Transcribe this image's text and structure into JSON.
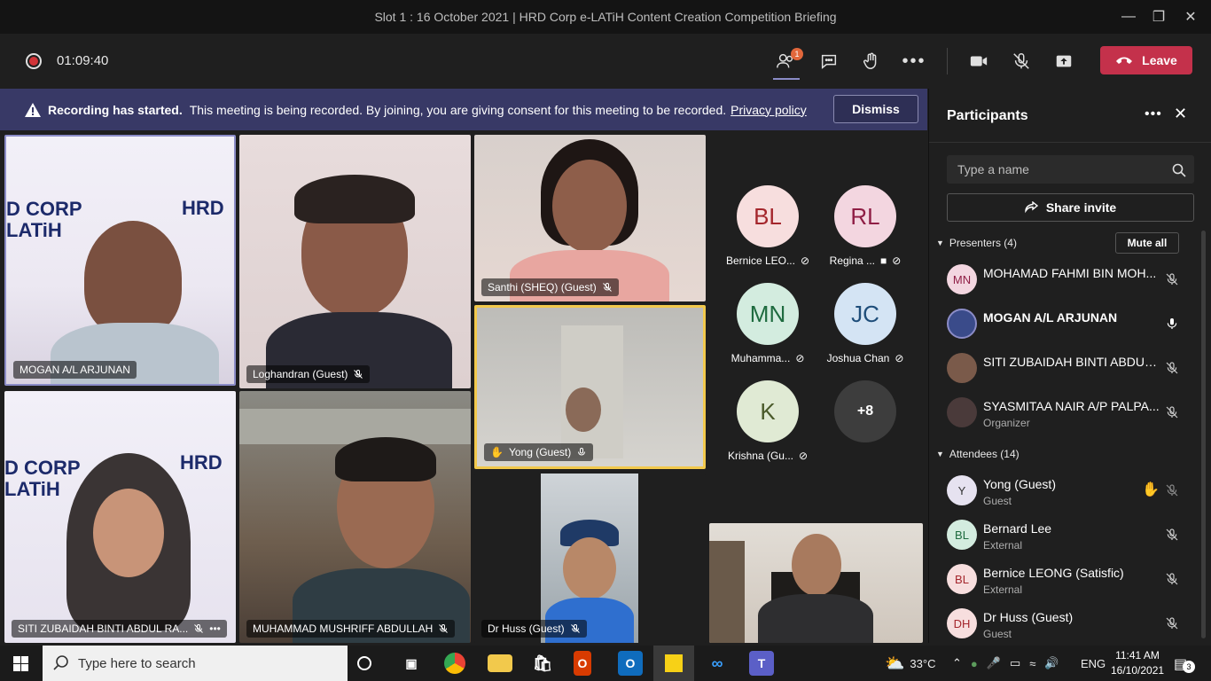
{
  "window": {
    "title": "Slot 1 : 16 October 2021 | HRD Corp e-LATiH Content Creation Competition Briefing"
  },
  "toolbar": {
    "timer": "01:09:40",
    "participants_badge": "1",
    "leave_label": "Leave"
  },
  "banner": {
    "bold": "Recording has started.",
    "text": "This meeting is being recorded. By joining, you are giving consent for this meeting to be recorded.",
    "link": "Privacy policy",
    "dismiss": "Dismiss"
  },
  "tiles": [
    {
      "name": "MOGAN A/L ARJUNAN"
    },
    {
      "name": "Loghandran (Guest)"
    },
    {
      "name": "Santhi (SHEQ) (Guest)"
    },
    {
      "name": "Yong (Guest)"
    },
    {
      "name": "SITI ZUBAIDAH BINTI ABDUL RA..."
    },
    {
      "name": "MUHAMMAD MUSHRIFF ABDULLAH"
    },
    {
      "name": "Dr Huss (Guest)"
    }
  ],
  "avatars": [
    {
      "initials": "BL",
      "label": "Bernice LEO...",
      "bg": "#f7dede",
      "fg": "#a4262c"
    },
    {
      "initials": "RL",
      "label": "Regina ...",
      "bg": "#f3d6e0",
      "fg": "#8f1e45"
    },
    {
      "initials": "MN",
      "label": "Muhamma...",
      "bg": "#d3ecdf",
      "fg": "#1e6b3f"
    },
    {
      "initials": "JC",
      "label": "Joshua Chan",
      "bg": "#d4e4f4",
      "fg": "#1f4e7a"
    },
    {
      "initials": "K",
      "label": "Krishna (Gu...",
      "bg": "#e0ead4",
      "fg": "#4a5a2a"
    },
    {
      "initials": "+8",
      "label": "",
      "bg": "#3d3d3d",
      "fg": "#ffffff"
    }
  ],
  "panel": {
    "title": "Participants",
    "search_placeholder": "Type a name",
    "share_invite": "Share invite",
    "presenters_header": "Presenters (4)",
    "mute_all": "Mute all",
    "presenters": [
      {
        "initials": "MN",
        "name": "MOHAMAD FAHMI BIN MOH...",
        "sub": "",
        "bg": "#f3d6e0"
      },
      {
        "initials": "",
        "name": "MOGAN A/L ARJUNAN",
        "sub": "",
        "bg": "#3a4b8a"
      },
      {
        "initials": "",
        "name": "SITI ZUBAIDAH BINTI ABDUL ...",
        "sub": "",
        "bg": "#7a5a4a"
      },
      {
        "initials": "",
        "name": "SYASMITAA NAIR A/P PALPA...",
        "sub": "Organizer",
        "bg": "#4a3a3a"
      }
    ],
    "attendees_header": "Attendees (14)",
    "attendees": [
      {
        "initials": "Y",
        "name": "Yong (Guest)",
        "sub": "Guest",
        "bg": "#e6e2f0"
      },
      {
        "initials": "BL",
        "name": "Bernard Lee",
        "sub": "External",
        "bg": "#d3ecdf"
      },
      {
        "initials": "BL",
        "name": "Bernice LEONG (Satisfic)",
        "sub": "External",
        "bg": "#f7dede"
      },
      {
        "initials": "DH",
        "name": "Dr Huss (Guest)",
        "sub": "Guest",
        "bg": "#f7dede"
      }
    ]
  },
  "taskbar": {
    "search_placeholder": "Type here to search",
    "temperature": "33°C",
    "language": "ENG",
    "time": "11:41 AM",
    "date": "16/10/2021",
    "notifications": "3"
  }
}
